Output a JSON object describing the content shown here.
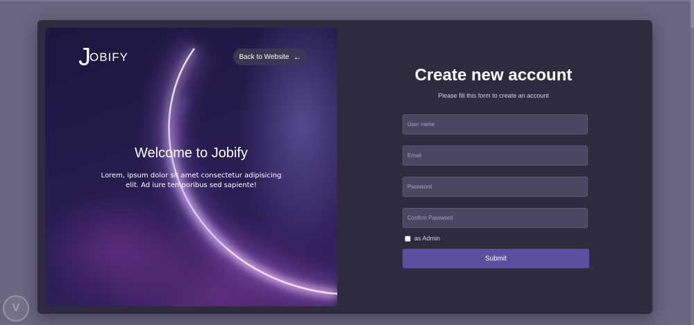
{
  "brand": {
    "logo_mark": "J",
    "logo_text": "OBIFY"
  },
  "hero": {
    "back_label": "Back to Website",
    "back_arrow": "←",
    "welcome_title": "Welcome to Jobify",
    "welcome_text": "Lorem, ipsum dolor sit amet consectetur adipisicing elit. Ad iure temporibus sed sapiente!"
  },
  "form": {
    "title": "Create new account",
    "subtitle": "Please fill this form to create an account",
    "username_placeholder": "User name",
    "email_placeholder": "Email",
    "password_placeholder": "Password",
    "confirm_placeholder": "Confirm Password",
    "admin_label": "as Admin",
    "admin_checked": false,
    "submit_label": "Submit"
  },
  "colors": {
    "page_bg": "#6b6680",
    "card_bg": "#2f2a3e",
    "input_bg": "#4c4760",
    "submit_bg": "#5e4ea0"
  },
  "watermark": {
    "glyph": "V"
  }
}
